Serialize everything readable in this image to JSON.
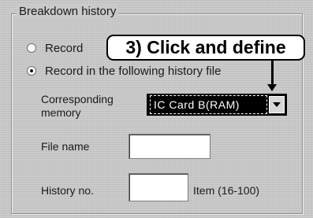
{
  "group": {
    "title": "Breakdown history"
  },
  "options": [
    {
      "label": "Record",
      "selected": false
    },
    {
      "label": "Record in the following history file",
      "selected": true
    }
  ],
  "callout": {
    "text": "3) Click and define"
  },
  "memory": {
    "label_line1": "Corresponding",
    "label_line2": "memory",
    "value": "IC Card B(RAM)"
  },
  "file_name": {
    "label": "File name",
    "value": ""
  },
  "history_no": {
    "label": "History no.",
    "value": "",
    "unit": "Item (16-100)"
  },
  "colors": {
    "highlight": "#000000",
    "selected_text": "#ffffff"
  },
  "icons": {
    "dropdown": "chevron-down-icon"
  }
}
